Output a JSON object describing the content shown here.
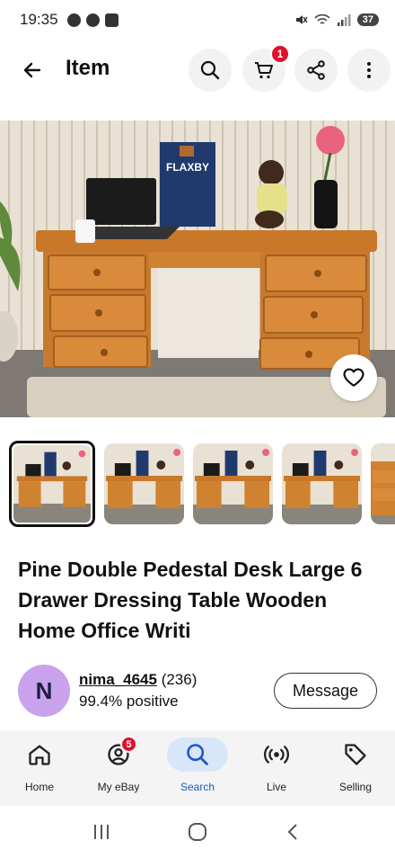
{
  "status_bar": {
    "time": "19:35",
    "battery": "37"
  },
  "header": {
    "title": "Item",
    "cart_badge": "1"
  },
  "listing": {
    "title": "Pine Double Pedestal Desk Large 6 Drawer Dressing Table Wooden Home Office Writi",
    "photo_sign_text": "FLAXBY"
  },
  "seller": {
    "initial": "N",
    "name": "nima_4645",
    "feedback_count": "(236)",
    "positive": "99.4% positive",
    "message_label": "Message"
  },
  "bottom_nav": {
    "items": [
      {
        "label": "Home",
        "icon": "home-icon"
      },
      {
        "label": "My eBay",
        "icon": "my-ebay-icon",
        "badge": "5"
      },
      {
        "label": "Search",
        "icon": "search-icon",
        "active": true
      },
      {
        "label": "Live",
        "icon": "live-icon"
      },
      {
        "label": "Selling",
        "icon": "tag-icon"
      }
    ]
  },
  "colors": {
    "accent": "#1f56c9",
    "badge": "#e0102c",
    "active_pill": "#d8e6f9",
    "avatar": "#c9a2ee"
  }
}
